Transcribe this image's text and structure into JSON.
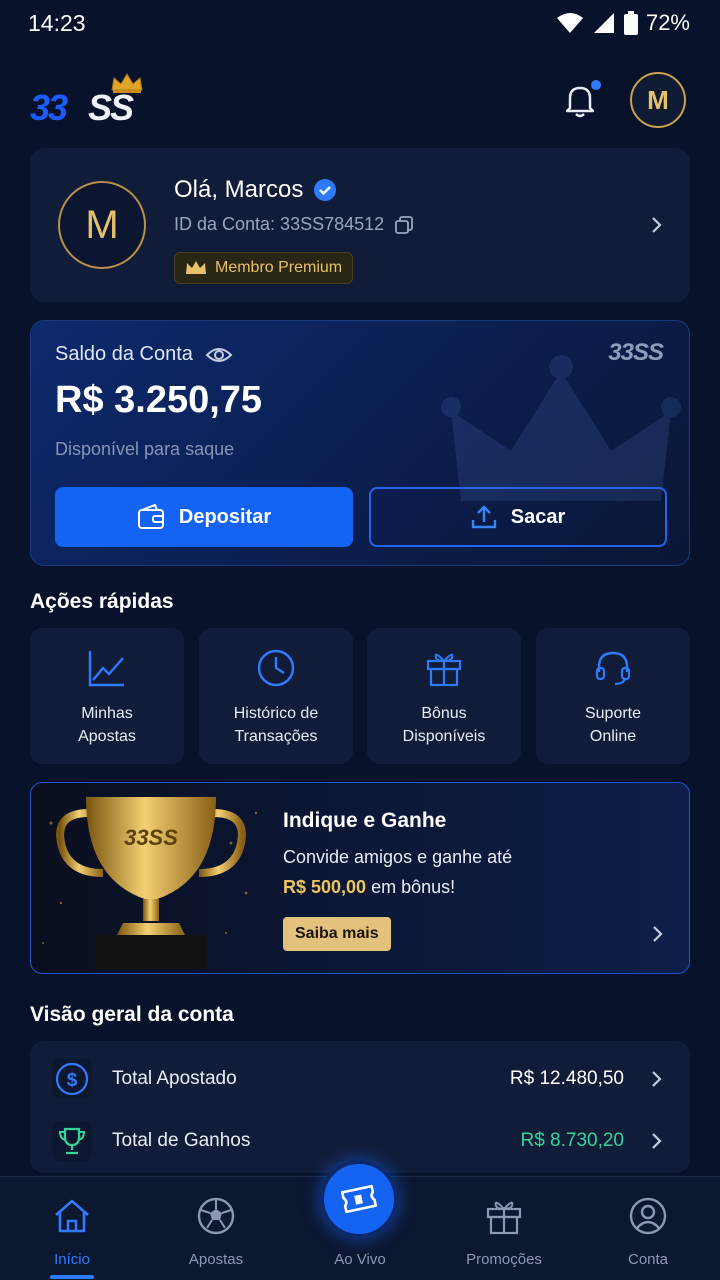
{
  "status_bar": {
    "time": "14:23",
    "battery": "72%"
  },
  "header": {
    "avatar_initial": "M"
  },
  "profile": {
    "initial": "M",
    "greeting": "Olá, Marcos",
    "account_id": "ID da Conta: 33SS784512",
    "badge": "Membro Premium"
  },
  "balance": {
    "title": "Saldo da Conta",
    "value": "R$ 3.250,75",
    "subtitle": "Disponível para saque",
    "brand": "33SS",
    "deposit_label": "Depositar",
    "withdraw_label": "Sacar"
  },
  "quick_actions": {
    "title": "Ações rápidas",
    "items": [
      {
        "label": "Minhas\nApostas",
        "icon": "chart-line-icon"
      },
      {
        "label": "Histórico de\nTransações",
        "icon": "clock-icon"
      },
      {
        "label": "Bônus\nDisponíveis",
        "icon": "gift-icon"
      },
      {
        "label": "Suporte\nOnline",
        "icon": "headset-icon"
      }
    ]
  },
  "referral": {
    "title": "Indique e Ganhe",
    "line1": "Convide amigos e ganhe até",
    "amount": "R$ 500,00",
    "line2_rest": " em bônus!",
    "button": "Saiba mais",
    "trophy_text": "33SS"
  },
  "overview": {
    "title": "Visão geral da conta",
    "rows": [
      {
        "label": "Total Apostado",
        "value": "R$ 12.480,50"
      },
      {
        "label": "Total de Ganhos",
        "value": "R$ 8.730,20"
      }
    ]
  },
  "nav": {
    "items": [
      "Início",
      "Apostas",
      "Ao Vivo",
      "Promoções",
      "Conta"
    ]
  },
  "colors": {
    "accent": "#1463f3",
    "gold": "#e6c06a",
    "green": "#34d399",
    "background": "#08122b"
  }
}
